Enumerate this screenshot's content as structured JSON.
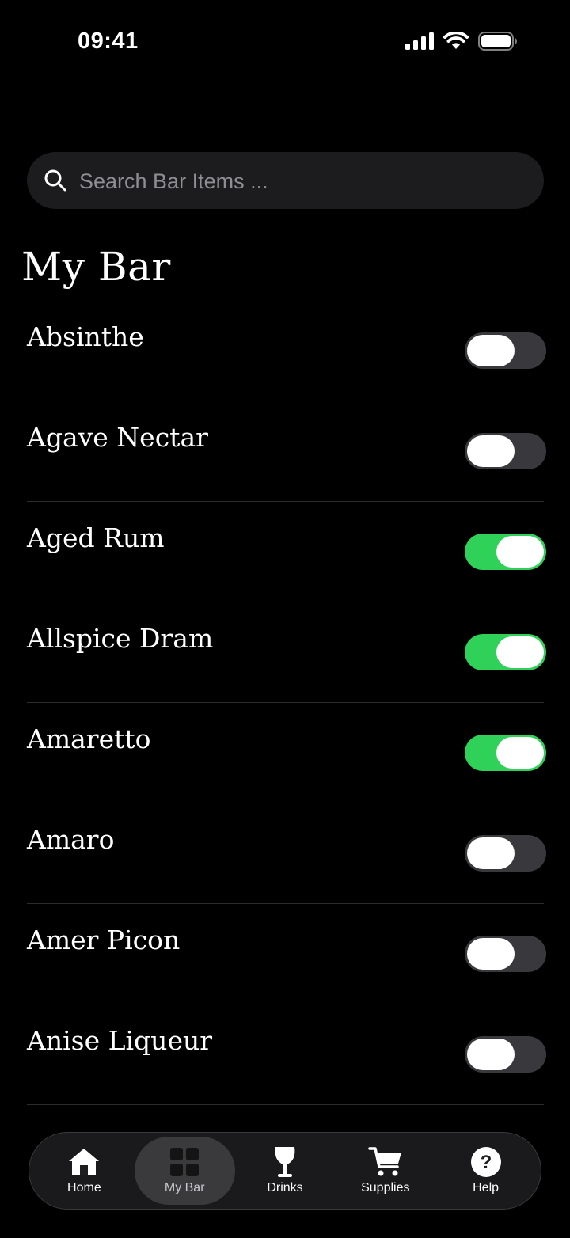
{
  "status_bar": {
    "time": "09:41"
  },
  "search": {
    "placeholder": "Search Bar Items ..."
  },
  "page": {
    "title": "My Bar"
  },
  "items": [
    {
      "label": "Absinthe",
      "on": false
    },
    {
      "label": "Agave Nectar",
      "on": false
    },
    {
      "label": "Aged Rum",
      "on": true
    },
    {
      "label": "Allspice Dram",
      "on": true
    },
    {
      "label": "Amaretto",
      "on": true
    },
    {
      "label": "Amaro",
      "on": false
    },
    {
      "label": "Amer Picon",
      "on": false
    },
    {
      "label": "Anise Liqueur",
      "on": false
    }
  ],
  "tabs": [
    {
      "label": "Home",
      "icon": "home-icon",
      "active": false
    },
    {
      "label": "My Bar",
      "icon": "grid-icon",
      "active": true
    },
    {
      "label": "Drinks",
      "icon": "wine-glass-icon",
      "active": false
    },
    {
      "label": "Supplies",
      "icon": "cart-icon",
      "active": false
    },
    {
      "label": "Help",
      "icon": "question-icon",
      "active": false
    }
  ],
  "colors": {
    "toggle_on": "#30d158",
    "toggle_off": "#39393d",
    "background": "#000000"
  }
}
